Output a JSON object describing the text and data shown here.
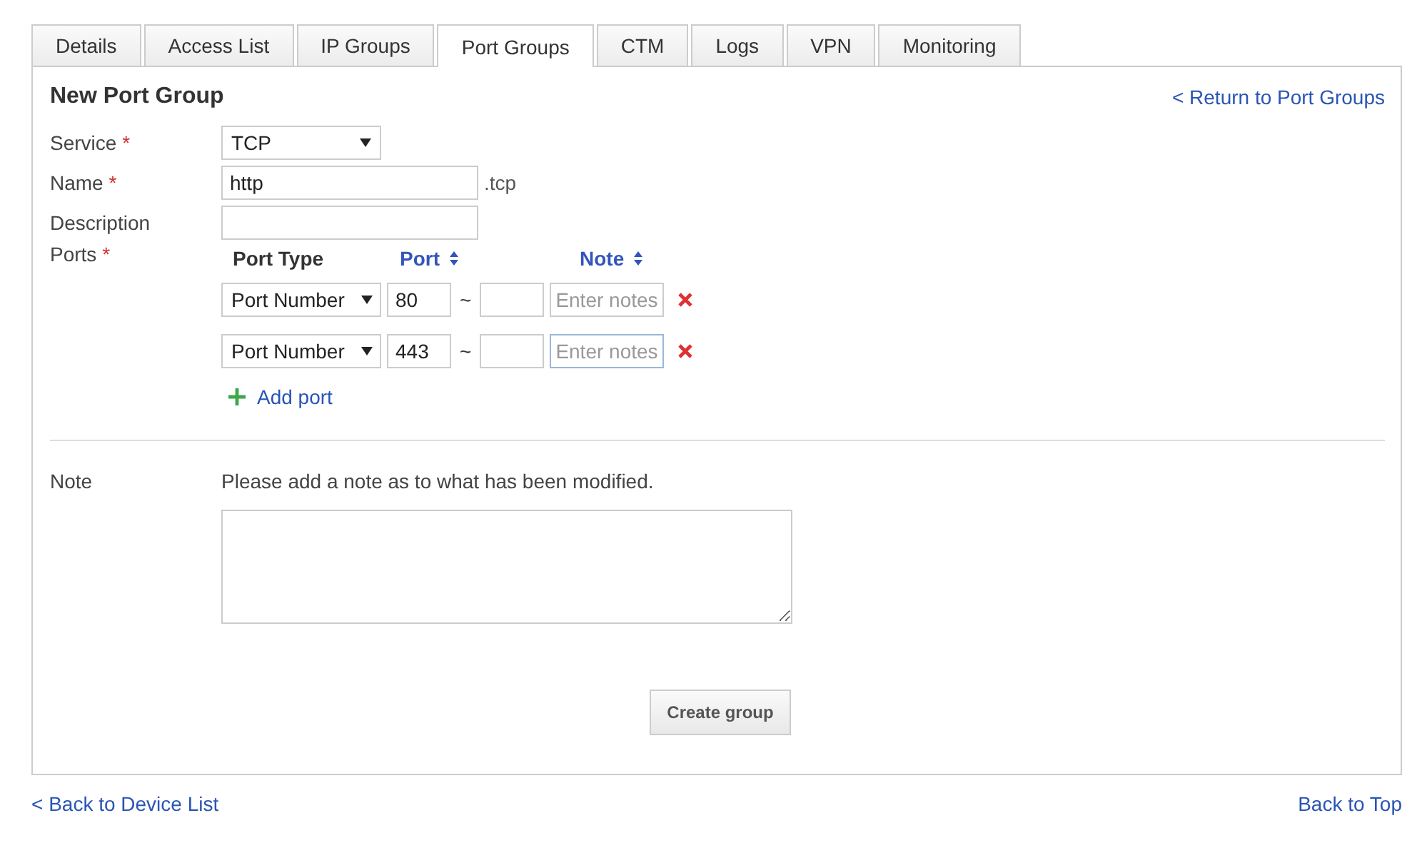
{
  "tabs": [
    {
      "label": "Details",
      "selected": false
    },
    {
      "label": "Access List",
      "selected": false
    },
    {
      "label": "IP Groups",
      "selected": false
    },
    {
      "label": "Port Groups",
      "selected": true
    },
    {
      "label": "CTM",
      "selected": false
    },
    {
      "label": "Logs",
      "selected": false
    },
    {
      "label": "VPN",
      "selected": false
    },
    {
      "label": "Monitoring",
      "selected": false
    }
  ],
  "form": {
    "title": "New Port Group",
    "return_link": "< Return to Port Groups",
    "service": {
      "label": "Service",
      "required_mark": "*",
      "value": "TCP"
    },
    "name": {
      "label": "Name",
      "required_mark": "*",
      "value": "http",
      "suffix": ".tcp"
    },
    "description": {
      "label": "Description"
    },
    "ports": {
      "label": "Ports",
      "required_mark": "*",
      "columns": [
        {
          "label": "Port Type",
          "sortable": false
        },
        {
          "label": "Port",
          "sortable": true
        },
        {
          "label": "Note",
          "sortable": true
        }
      ],
      "rows": [
        {
          "port_type": "Port Number",
          "port": "80",
          "separator": "~",
          "note_placeholder": "Enter notes",
          "focused": false
        },
        {
          "port_type": "Port Number",
          "port": "443",
          "separator": "~",
          "note_placeholder": "Enter notes",
          "focused": true
        }
      ],
      "add_link": "Add port"
    },
    "note": {
      "label": "Note",
      "hint": "Please add a note as to what has been modified."
    },
    "submit": "Create group"
  },
  "footer": {
    "back_link": "< Back to Device List",
    "top_link": "Back to Top"
  }
}
